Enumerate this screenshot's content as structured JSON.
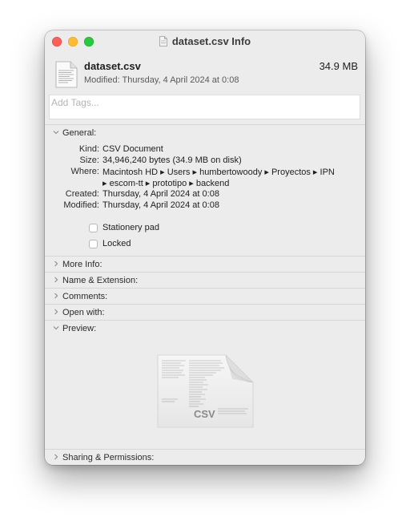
{
  "window": {
    "title": "dataset.csv Info"
  },
  "header": {
    "file_name": "dataset.csv",
    "file_size": "34.9 MB",
    "modified": "Modified: Thursday, 4 April 2024 at 0:08"
  },
  "tags": {
    "placeholder": "Add Tags..."
  },
  "sections": {
    "general": "General:",
    "more_info": "More Info:",
    "name_extension": "Name & Extension:",
    "comments": "Comments:",
    "open_with": "Open with:",
    "preview": "Preview:",
    "sharing": "Sharing & Permissions:"
  },
  "general": {
    "kind_label": "Kind:",
    "kind": "CSV Document",
    "size_label": "Size:",
    "size": "34,946,240 bytes (34.9 MB on disk)",
    "where_label": "Where:",
    "where_line1": "Macintosh HD ▸ Users ▸ humbertowoody ▸ Proyectos ▸ IPN",
    "where_line2": "▸ escom-tt ▸ prototipo ▸ backend",
    "created_label": "Created:",
    "created": "Thursday, 4 April 2024 at 0:08",
    "modified_label": "Modified:",
    "modified": "Thursday, 4 April 2024 at 0:08",
    "stationery_pad": "Stationery pad",
    "stationery_pad_checked": false,
    "locked": "Locked",
    "locked_checked": false
  },
  "preview": {
    "badge": "CSV"
  }
}
